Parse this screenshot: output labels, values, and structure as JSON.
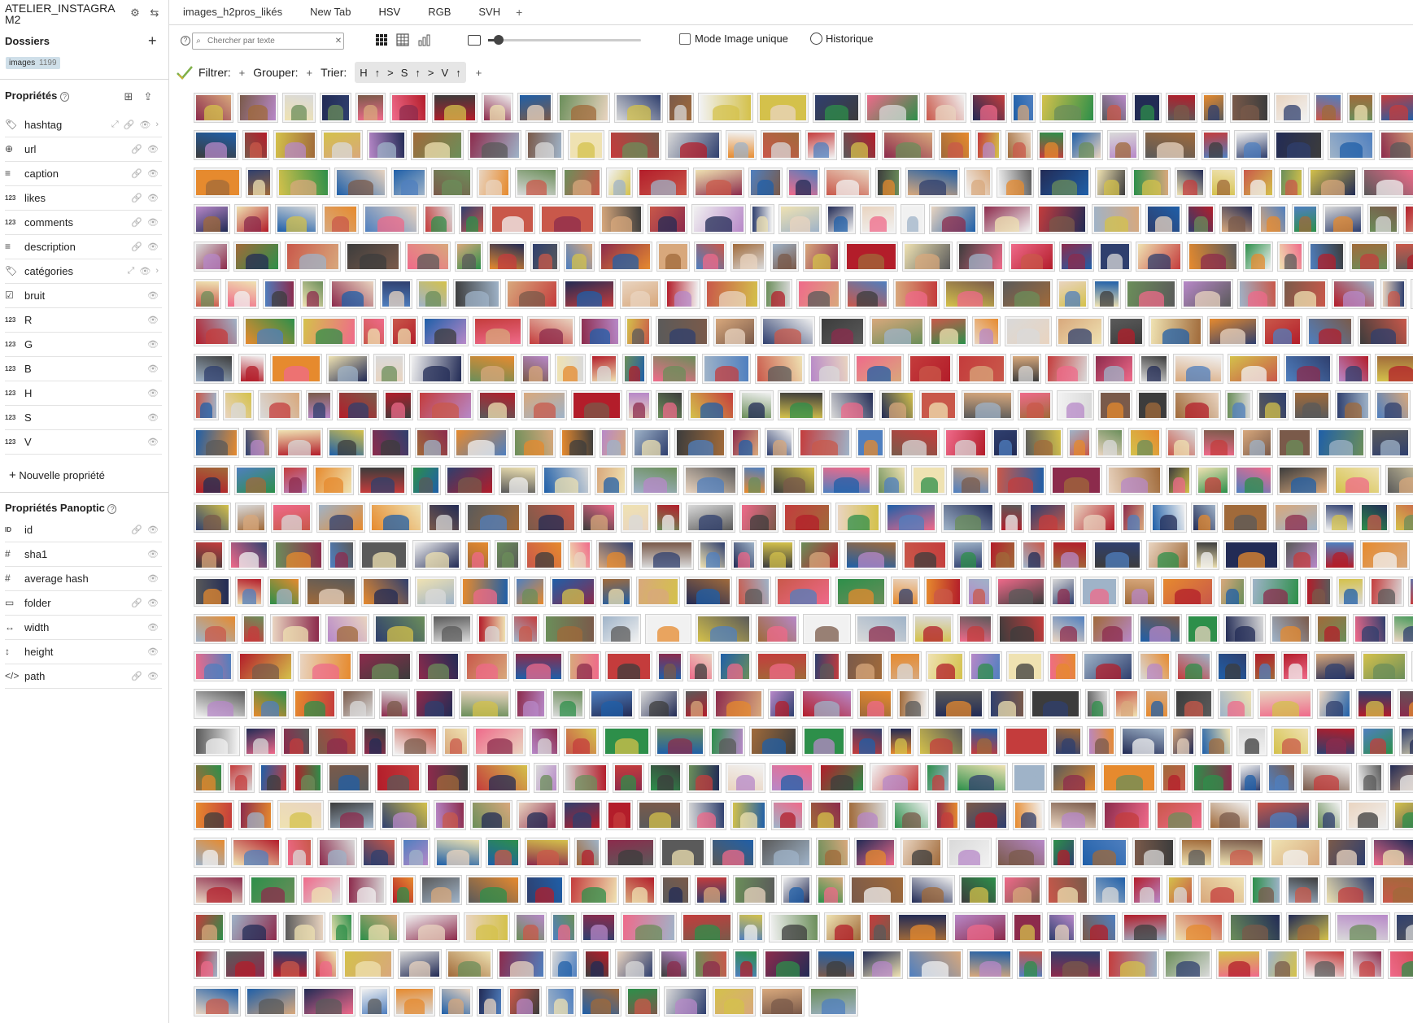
{
  "app": {
    "title": "ATELIER_INSTAGRAM2"
  },
  "tabs": [
    {
      "label": "images_h2pros_likés"
    },
    {
      "label": "New Tab"
    },
    {
      "label": "HSV",
      "active": true
    },
    {
      "label": "RGB"
    },
    {
      "label": "SVH"
    }
  ],
  "sidebar": {
    "folders_title": "Dossiers",
    "folder": {
      "label": "images",
      "count": "1199"
    },
    "properties_title": "Propriétés",
    "properties": [
      {
        "label": "hashtag",
        "type": "tag",
        "icons": [
          "expand-icon",
          "link-icon",
          "eye-icon",
          "chevron-right-icon"
        ]
      },
      {
        "label": "url",
        "type": "globe",
        "icons": [
          "link-icon",
          "eye-icon"
        ]
      },
      {
        "label": "caption",
        "type": "text",
        "icons": [
          "link-icon",
          "eye-icon"
        ]
      },
      {
        "label": "likes",
        "type": "123",
        "icons": [
          "link-icon",
          "eye-icon"
        ]
      },
      {
        "label": "comments",
        "type": "123",
        "icons": [
          "link-icon",
          "eye-icon"
        ]
      },
      {
        "label": "description",
        "type": "text",
        "icons": [
          "link-icon",
          "eye-icon"
        ]
      },
      {
        "label": "catégories",
        "type": "tag",
        "icons": [
          "expand-icon",
          "eye-icon",
          "chevron-right-icon"
        ]
      },
      {
        "label": "bruit",
        "type": "checkbox",
        "icons": [
          "eye-icon"
        ]
      },
      {
        "label": "R",
        "type": "123",
        "icons": [
          "eye-icon"
        ]
      },
      {
        "label": "G",
        "type": "123",
        "icons": [
          "eye-icon"
        ]
      },
      {
        "label": "B",
        "type": "123",
        "icons": [
          "eye-icon"
        ]
      },
      {
        "label": "H",
        "type": "123",
        "icons": [
          "eye-icon"
        ]
      },
      {
        "label": "S",
        "type": "123",
        "icons": [
          "eye-icon"
        ]
      },
      {
        "label": "V",
        "type": "123",
        "icons": [
          "eye-icon"
        ]
      }
    ],
    "new_property": "Nouvelle propriété",
    "panoptic_title": "Propriétés Panoptic",
    "panoptic_properties": [
      {
        "label": "id",
        "type": "ID",
        "icons": [
          "link-icon",
          "eye-icon"
        ]
      },
      {
        "label": "sha1",
        "type": "#",
        "icons": [
          "eye-icon"
        ]
      },
      {
        "label": "average hash",
        "type": "#",
        "icons": [
          "eye-icon"
        ]
      },
      {
        "label": "folder",
        "type": "folder",
        "icons": [
          "link-icon",
          "eye-icon"
        ]
      },
      {
        "label": "width",
        "type": "↔",
        "icons": [
          "eye-icon"
        ]
      },
      {
        "label": "height",
        "type": "↕",
        "icons": [
          "eye-icon"
        ]
      },
      {
        "label": "path",
        "type": "</>",
        "icons": [
          "link-icon",
          "eye-icon"
        ]
      }
    ]
  },
  "toolbar": {
    "search_placeholder": "Chercher par texte",
    "zoom_level": 0.05,
    "mode_unique_label": "Mode Image unique",
    "historique_label": "Historique"
  },
  "filterbar": {
    "filter_label": "Filtrer:",
    "group_label": "Grouper:",
    "sort_label": "Trier:",
    "sort_keys": [
      "H",
      "S",
      "V"
    ]
  },
  "grid": {
    "total_images": 1199,
    "colors": [
      "#c9584a",
      "#7a5a4a",
      "#d8a87c",
      "#2f3f6e",
      "#b31d2a",
      "#e9d4c0",
      "#3c3c3c",
      "#f1f1f1",
      "#1f5fa8",
      "#a06a3a",
      "#d4c14b",
      "#6b8e5a",
      "#e68a2e",
      "#8c2b4c",
      "#4f7fbf",
      "#d9d9d9",
      "#222b55",
      "#c43c3c",
      "#efe2b2",
      "#5a5a5a",
      "#2d8f4a",
      "#b788c8",
      "#ef6a8a",
      "#9fb3c8"
    ]
  }
}
